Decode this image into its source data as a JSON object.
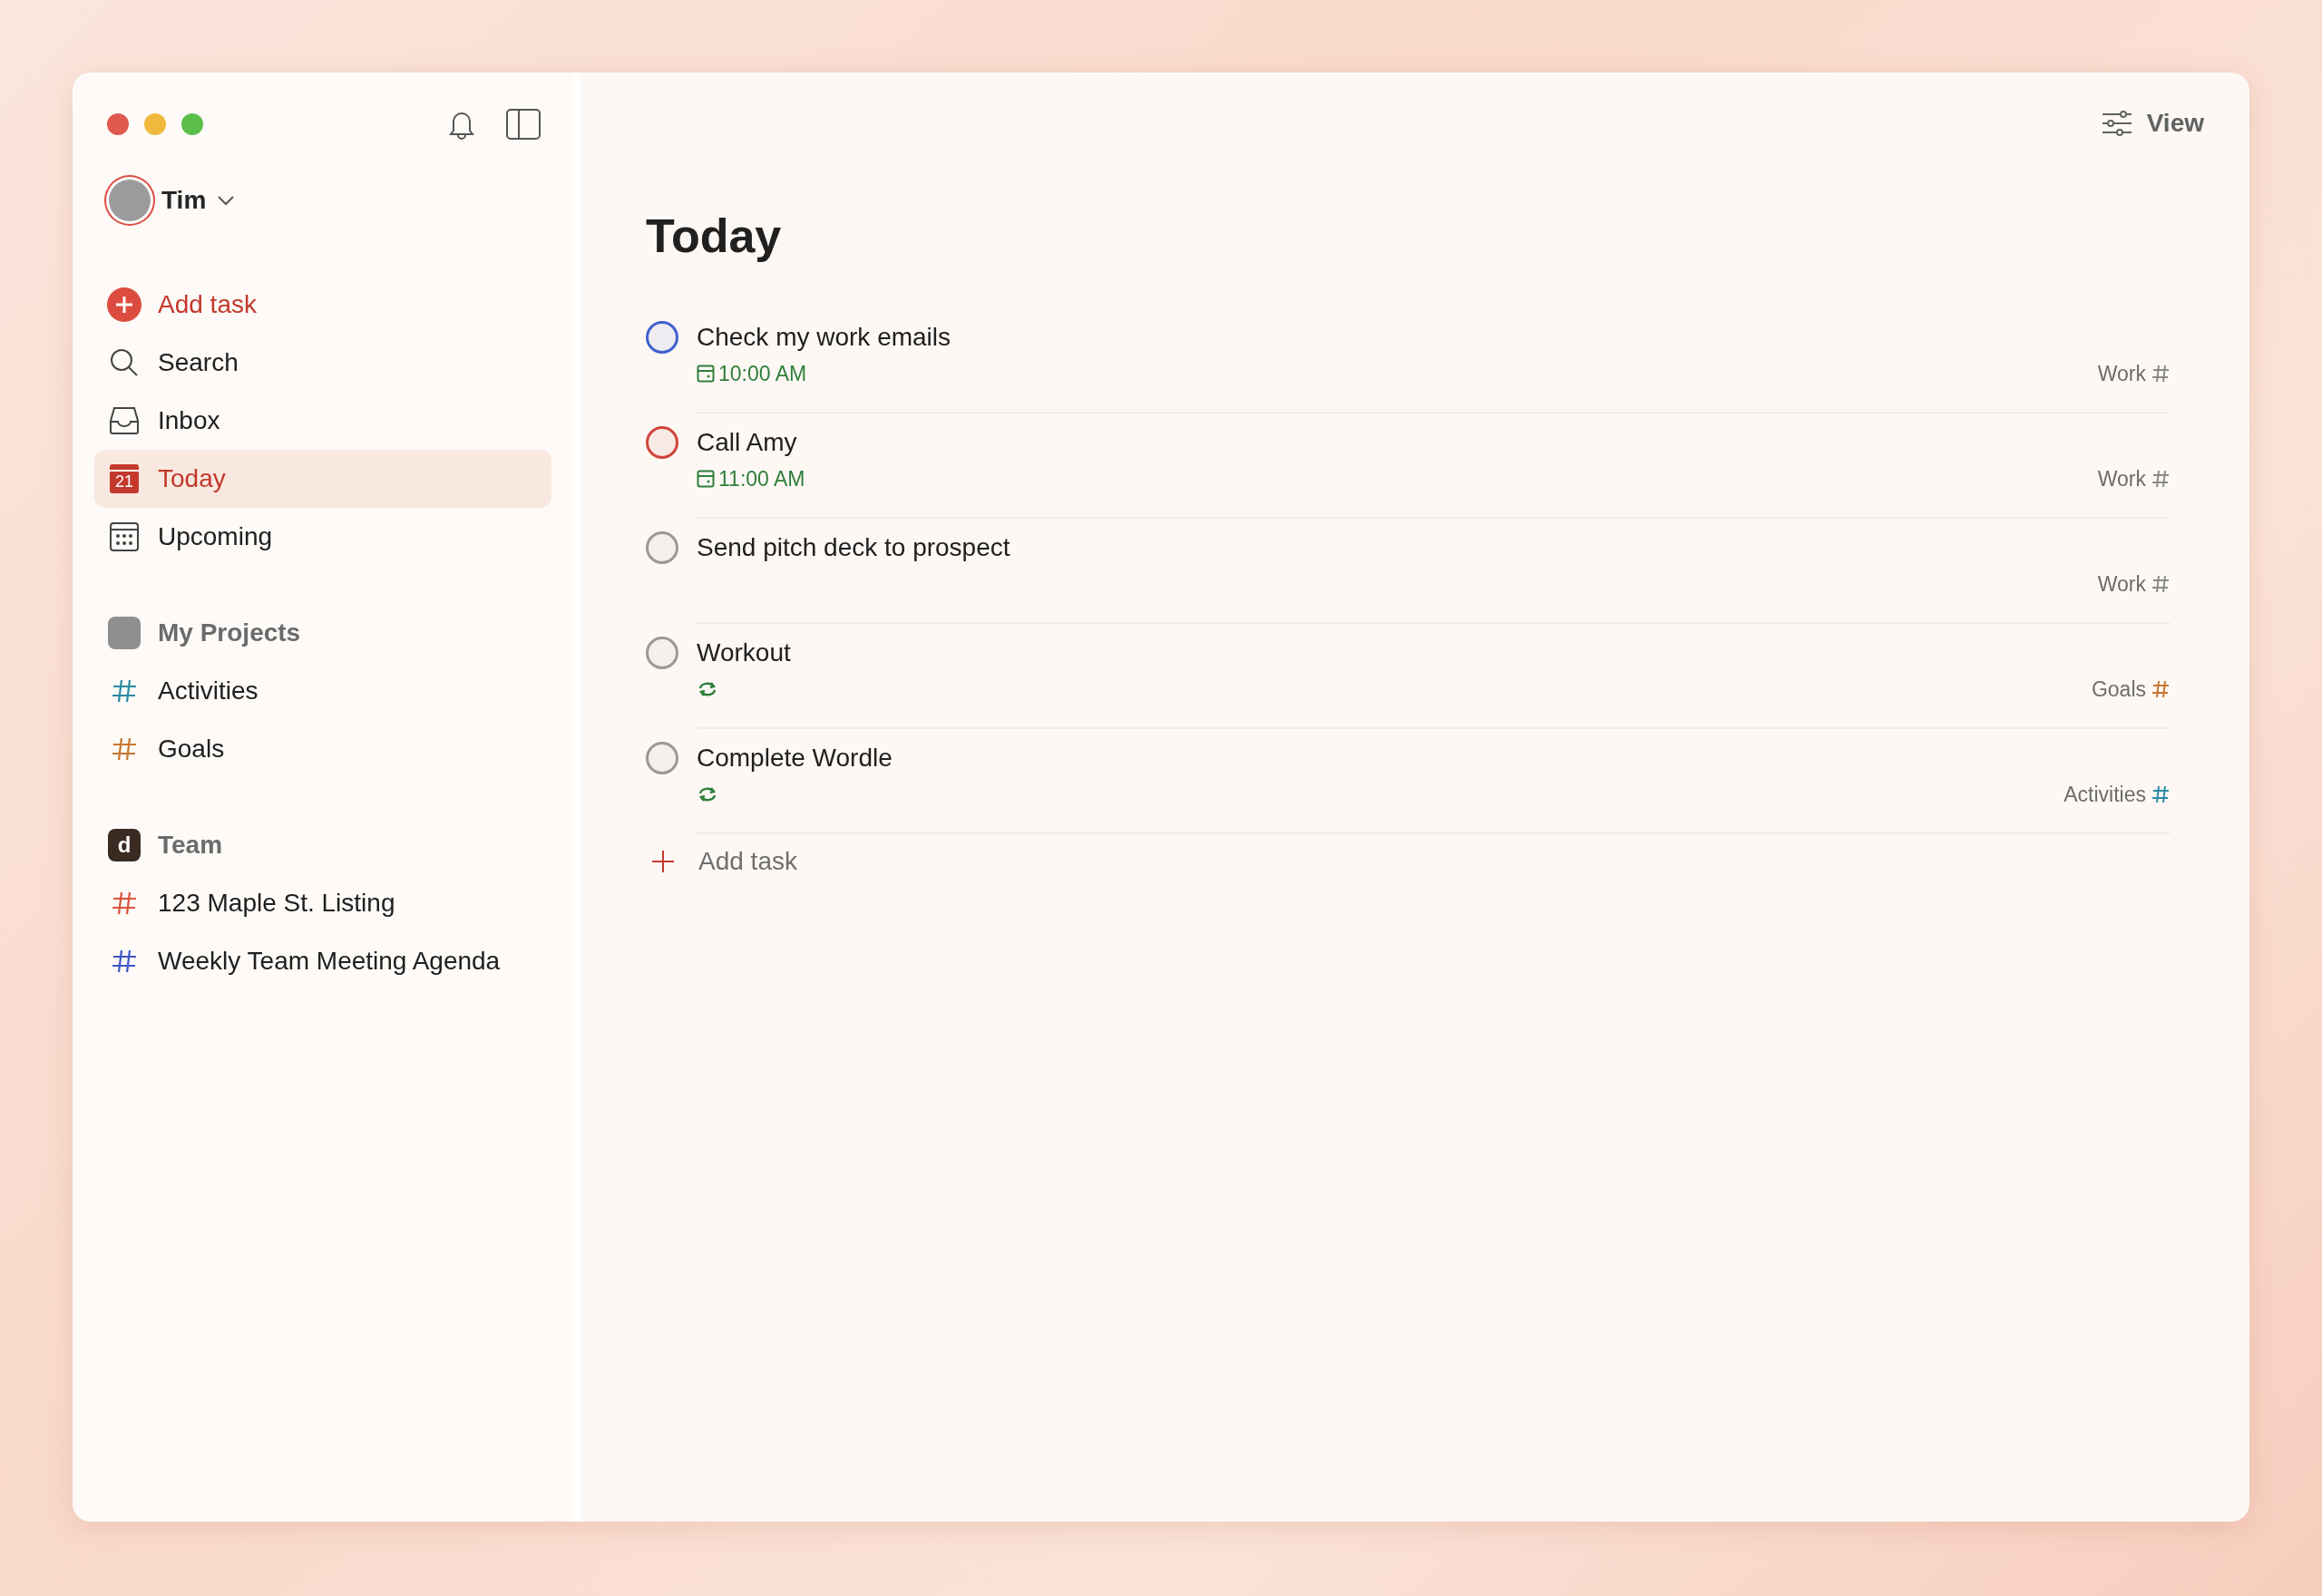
{
  "sidebar": {
    "user": {
      "name": "Tim"
    },
    "nav": [
      {
        "kind": "add",
        "label": "Add task",
        "selected": false
      },
      {
        "kind": "search",
        "label": "Search",
        "selected": false
      },
      {
        "kind": "inbox",
        "label": "Inbox",
        "selected": false
      },
      {
        "kind": "today",
        "label": "Today",
        "badge": "21",
        "selected": true
      },
      {
        "kind": "upcoming",
        "label": "Upcoming",
        "selected": false
      }
    ],
    "groups": [
      {
        "kind": "photo",
        "title": "My Projects",
        "projects": [
          {
            "name": "Activities",
            "color": "#2a8aa4"
          },
          {
            "name": "Goals",
            "color": "#c8762f"
          }
        ]
      },
      {
        "kind": "letter",
        "letter": "d",
        "title": "Team",
        "projects": [
          {
            "name": "123 Maple St. Listing",
            "color": "#d9533b"
          },
          {
            "name": "Weekly Team Meeting Agenda",
            "color": "#3f57c7"
          }
        ]
      }
    ]
  },
  "main": {
    "view_button": "View",
    "title": "Today",
    "tasks": [
      {
        "title": "Check my work emails",
        "color": "#3f61d0",
        "due": {
          "kind": "time",
          "text": "10:00 AM"
        },
        "project": {
          "name": "Work",
          "color": "#8a8a8a"
        }
      },
      {
        "title": "Call Amy",
        "color": "#d1453b",
        "due": {
          "kind": "time",
          "text": "11:00 AM"
        },
        "project": {
          "name": "Work",
          "color": "#8a8a8a"
        }
      },
      {
        "title": "Send pitch deck to prospect",
        "color": "#999999",
        "project": {
          "name": "Work",
          "color": "#8a8a8a"
        }
      },
      {
        "title": "Workout",
        "color": "#999999",
        "due": {
          "kind": "recurring"
        },
        "project": {
          "name": "Goals",
          "color": "#c8762f"
        }
      },
      {
        "title": "Complete Wordle",
        "color": "#999999",
        "due": {
          "kind": "recurring"
        },
        "project": {
          "name": "Activities",
          "color": "#2a8aa4"
        }
      }
    ],
    "add_task": "Add task"
  }
}
